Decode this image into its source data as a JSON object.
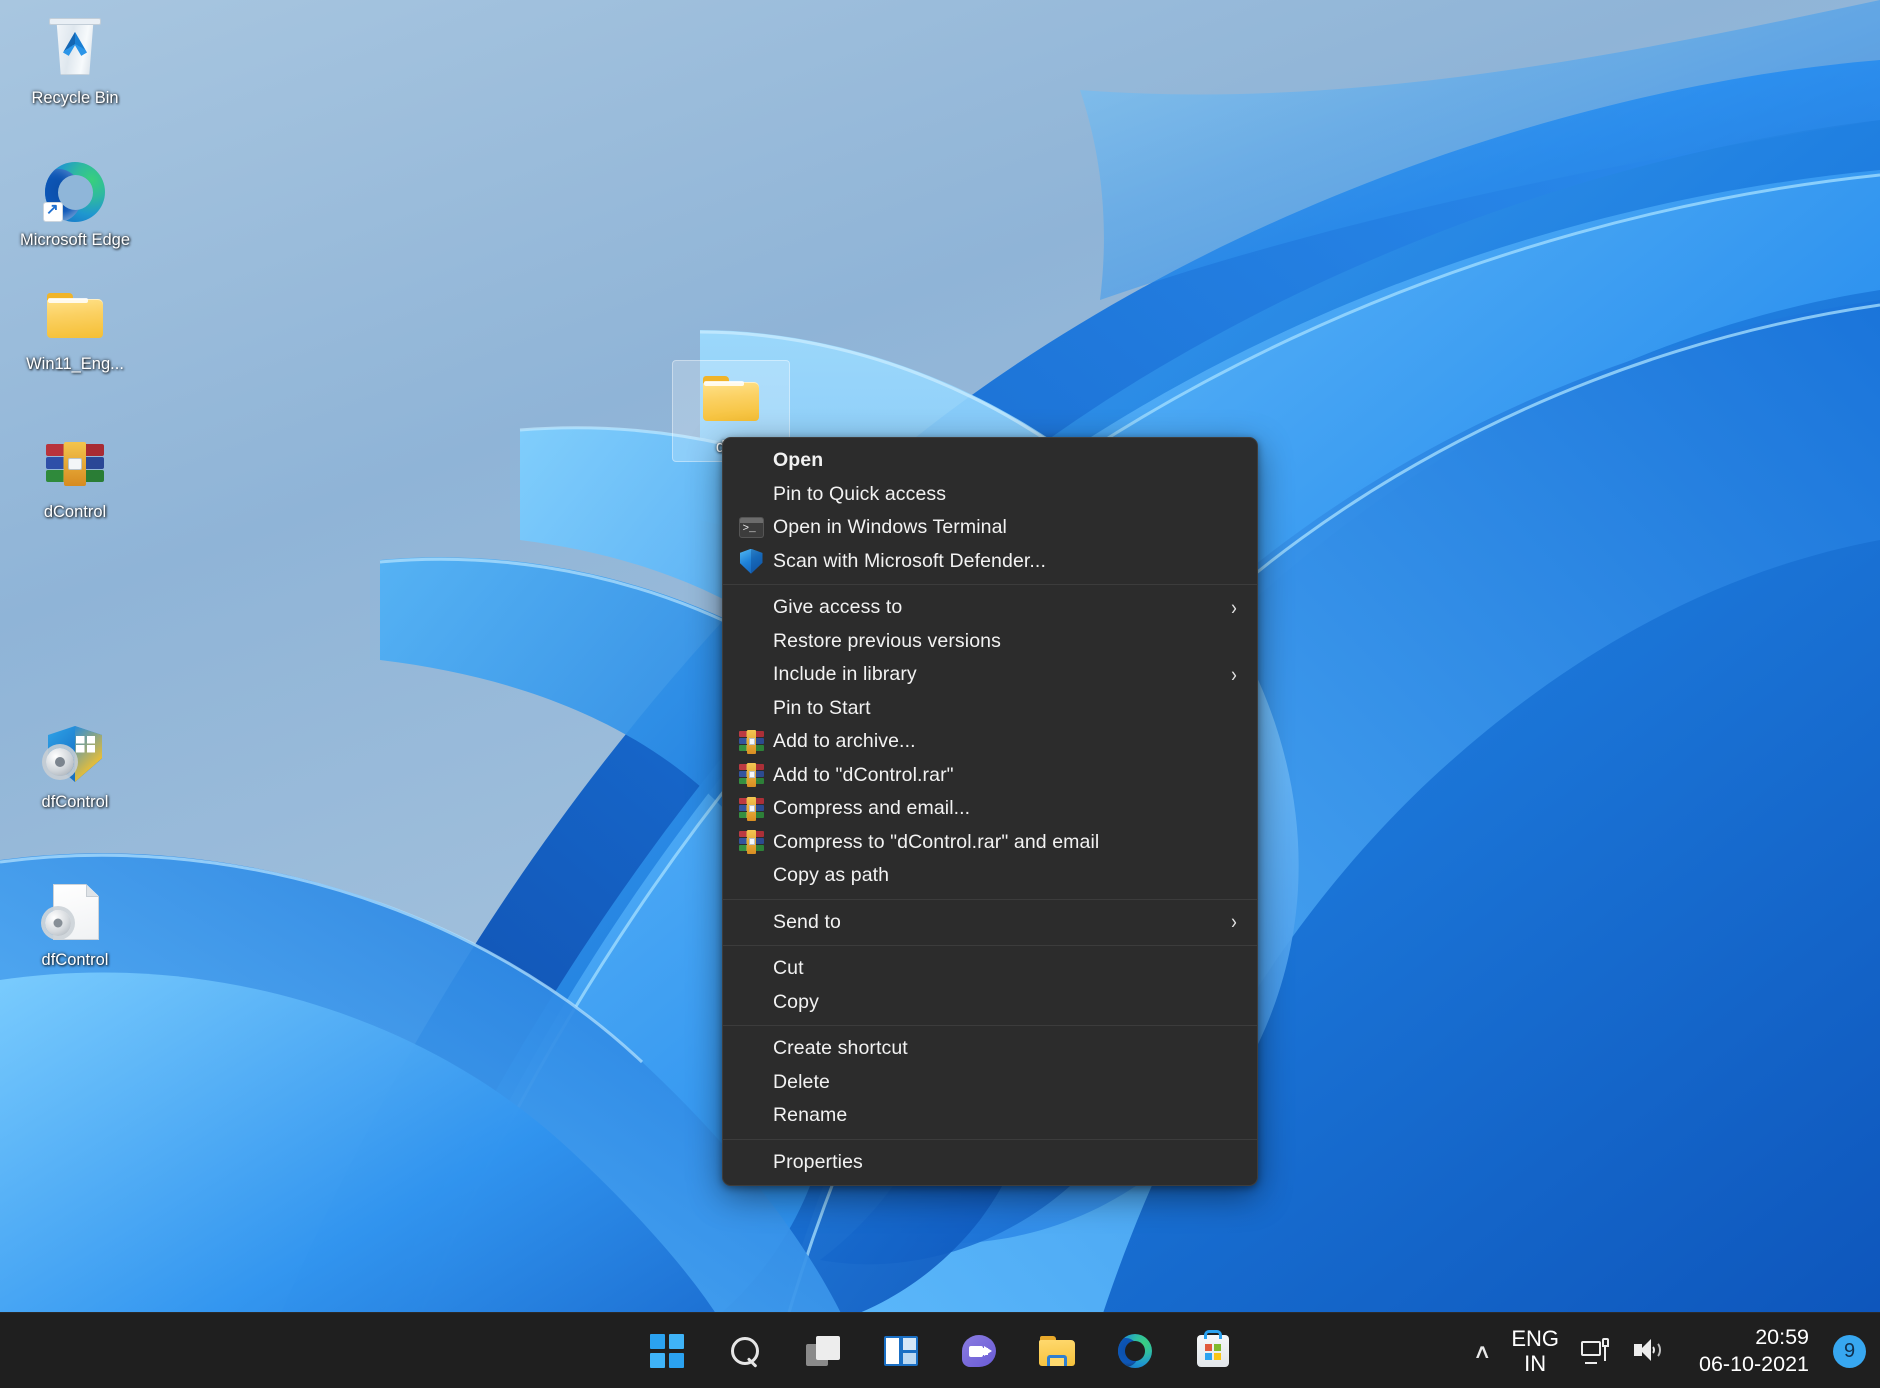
{
  "desktop": {
    "icons": [
      {
        "label": "Recycle Bin",
        "icon": "recycle-bin-icon",
        "selected": false
      },
      {
        "label": "Microsoft Edge",
        "icon": "microsoft-edge-shortcut-icon",
        "selected": false
      },
      {
        "label": "Win11_Eng...",
        "icon": "folder-icon",
        "selected": false
      },
      {
        "label": "dControl",
        "icon": "winrar-archive-icon",
        "selected": false
      },
      {
        "label": "dfControl",
        "icon": "shield-gear-icon",
        "selected": false
      },
      {
        "label": "dfControl",
        "icon": "document-gear-icon",
        "selected": false
      }
    ],
    "selected_folder": {
      "label": "dCo",
      "icon": "folder-icon"
    }
  },
  "context_menu": {
    "groups": [
      {
        "items": [
          {
            "label": "Open",
            "icon": null,
            "bold": true,
            "submenu": false
          },
          {
            "label": "Pin to Quick access",
            "icon": null,
            "bold": false,
            "submenu": false
          },
          {
            "label": "Open in Windows Terminal",
            "icon": "windows-terminal-icon",
            "bold": false,
            "submenu": false
          },
          {
            "label": "Scan with Microsoft Defender...",
            "icon": "microsoft-defender-icon",
            "bold": false,
            "submenu": false
          }
        ]
      },
      {
        "items": [
          {
            "label": "Give access to",
            "icon": null,
            "bold": false,
            "submenu": true
          },
          {
            "label": "Restore previous versions",
            "icon": null,
            "bold": false,
            "submenu": false
          },
          {
            "label": "Include in library",
            "icon": null,
            "bold": false,
            "submenu": true
          },
          {
            "label": "Pin to Start",
            "icon": null,
            "bold": false,
            "submenu": false
          },
          {
            "label": "Add to archive...",
            "icon": "winrar-icon",
            "bold": false,
            "submenu": false
          },
          {
            "label": "Add to \"dControl.rar\"",
            "icon": "winrar-icon",
            "bold": false,
            "submenu": false
          },
          {
            "label": "Compress and email...",
            "icon": "winrar-icon",
            "bold": false,
            "submenu": false
          },
          {
            "label": "Compress to \"dControl.rar\" and email",
            "icon": "winrar-icon",
            "bold": false,
            "submenu": false
          },
          {
            "label": "Copy as path",
            "icon": null,
            "bold": false,
            "submenu": false
          }
        ]
      },
      {
        "items": [
          {
            "label": "Send to",
            "icon": null,
            "bold": false,
            "submenu": true
          }
        ]
      },
      {
        "items": [
          {
            "label": "Cut",
            "icon": null,
            "bold": false,
            "submenu": false
          },
          {
            "label": "Copy",
            "icon": null,
            "bold": false,
            "submenu": false
          }
        ]
      },
      {
        "items": [
          {
            "label": "Create shortcut",
            "icon": null,
            "bold": false,
            "submenu": false
          },
          {
            "label": "Delete",
            "icon": null,
            "bold": false,
            "submenu": false
          },
          {
            "label": "Rename",
            "icon": null,
            "bold": false,
            "submenu": false
          }
        ]
      },
      {
        "items": [
          {
            "label": "Properties",
            "icon": null,
            "bold": false,
            "submenu": false
          }
        ]
      }
    ],
    "submenu_chevron": "›",
    "background_color": "#2c2c2c",
    "text_color": "#f2f2f2"
  },
  "taskbar": {
    "buttons": [
      {
        "name": "start-button",
        "label": "Start"
      },
      {
        "name": "search-button",
        "label": "Search"
      },
      {
        "name": "task-view-button",
        "label": "Task View"
      },
      {
        "name": "widgets-button",
        "label": "Widgets"
      },
      {
        "name": "chat-button",
        "label": "Chat"
      },
      {
        "name": "file-explorer-button",
        "label": "File Explorer"
      },
      {
        "name": "microsoft-edge-button",
        "label": "Microsoft Edge"
      },
      {
        "name": "microsoft-store-button",
        "label": "Microsoft Store"
      }
    ],
    "tray": {
      "overflow_chevron": "∧",
      "language_line1": "ENG",
      "language_line2": "IN",
      "network_icon": "network-icon",
      "volume_icon": "volume-icon",
      "time": "20:59",
      "date": "06-10-2021",
      "notification_count": "9",
      "notification_badge_color": "#37a7f0"
    },
    "background_color": "#1f1f1f"
  }
}
